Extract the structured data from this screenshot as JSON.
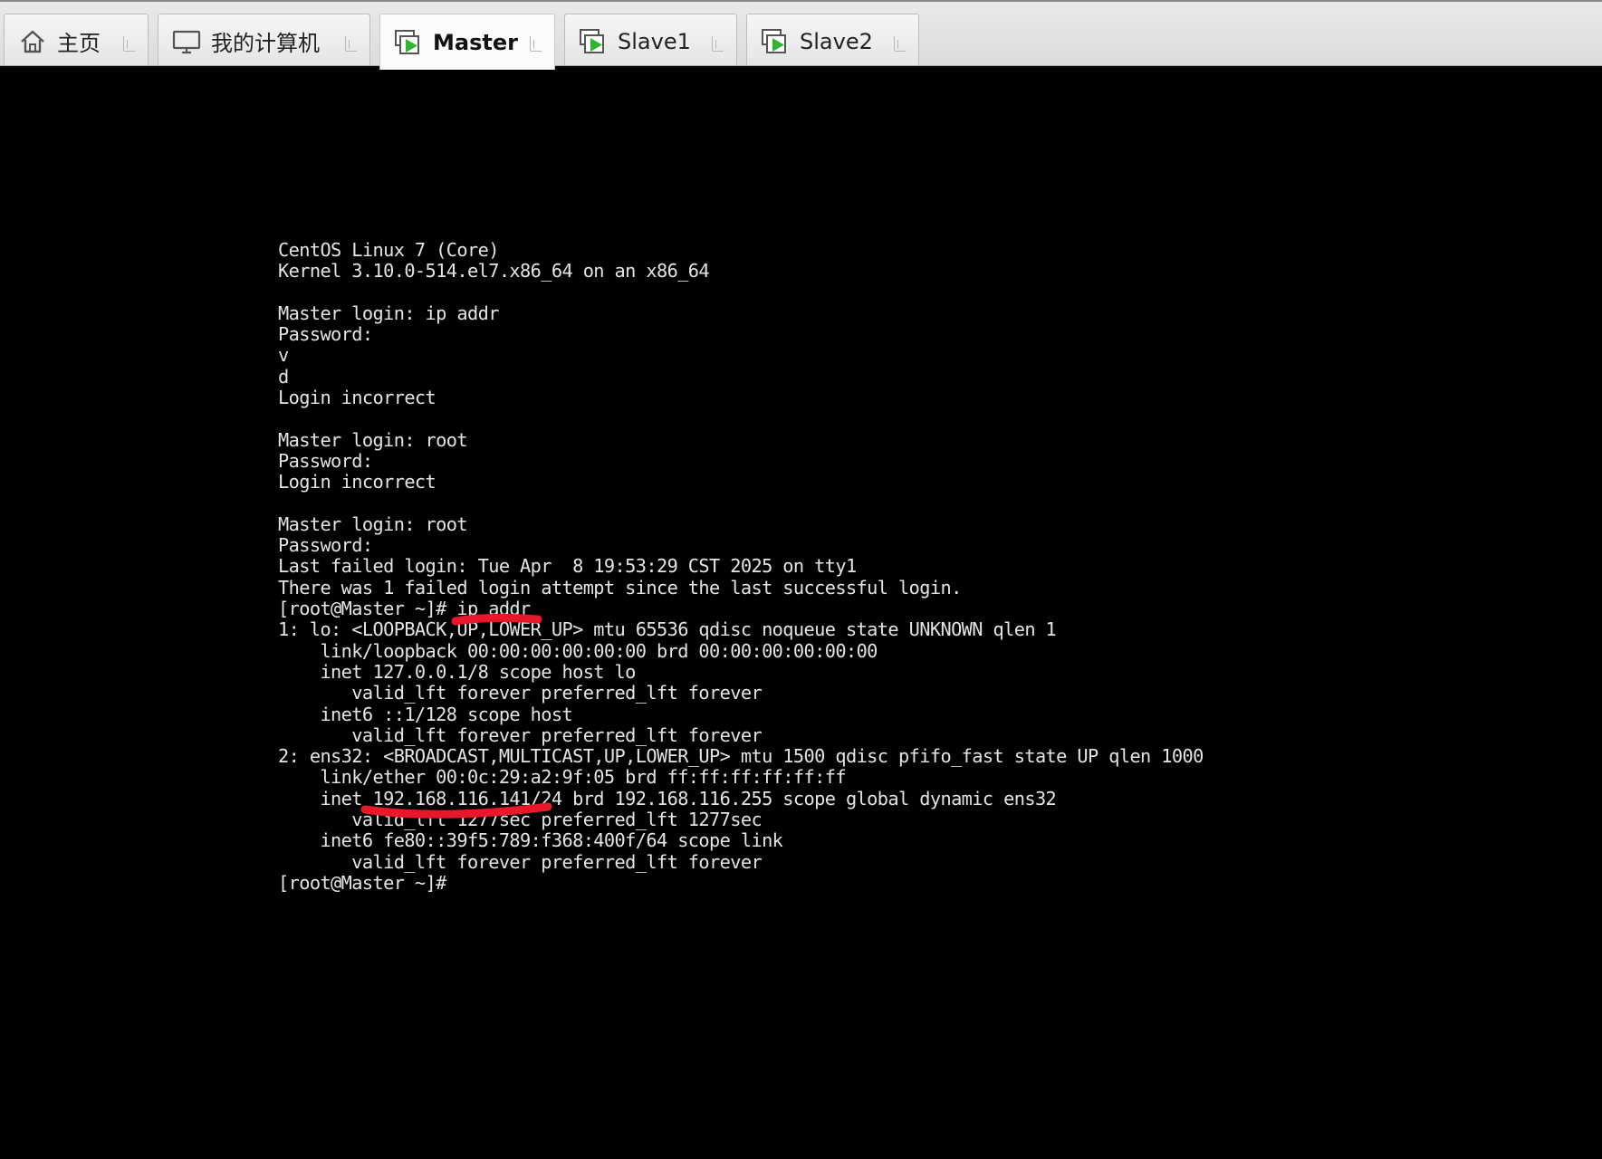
{
  "tabs": [
    {
      "label": "主页",
      "icon": "home-icon",
      "active": false
    },
    {
      "label": "我的计算机",
      "icon": "computer-icon",
      "active": false
    },
    {
      "label": "Master",
      "icon": "vm-running-icon",
      "active": true
    },
    {
      "label": "Slave1",
      "icon": "vm-running-icon",
      "active": false
    },
    {
      "label": "Slave2",
      "icon": "vm-running-icon",
      "active": false
    }
  ],
  "colors": {
    "console_bg": "#000000",
    "console_text": "#e4e4e4",
    "annotation_red": "#e8182a",
    "vm_play_green": "#2fb52f"
  },
  "terminal": {
    "lines": [
      "CentOS Linux 7 (Core)",
      "Kernel 3.10.0-514.el7.x86_64 on an x86_64",
      "",
      "Master login: ip addr",
      "Password:",
      "v",
      "d",
      "Login incorrect",
      "",
      "Master login: root",
      "Password:",
      "Login incorrect",
      "",
      "Master login: root",
      "Password:",
      "Last failed login: Tue Apr  8 19:53:29 CST 2025 on tty1",
      "There was 1 failed login attempt since the last successful login.",
      "[root@Master ~]# ip addr",
      "1: lo: <LOOPBACK,UP,LOWER_UP> mtu 65536 qdisc noqueue state UNKNOWN qlen 1",
      "    link/loopback 00:00:00:00:00:00 brd 00:00:00:00:00:00",
      "    inet 127.0.0.1/8 scope host lo",
      "       valid_lft forever preferred_lft forever",
      "    inet6 ::1/128 scope host",
      "       valid_lft forever preferred_lft forever",
      "2: ens32: <BROADCAST,MULTICAST,UP,LOWER_UP> mtu 1500 qdisc pfifo_fast state UP qlen 1000",
      "    link/ether 00:0c:29:a2:9f:05 brd ff:ff:ff:ff:ff:ff",
      "    inet 192.168.116.141/24 brd 192.168.116.255 scope global dynamic ens32",
      "       valid_lft 1277sec preferred_lft 1277sec",
      "    inet6 fe80::39f5:789:f368:400f/64 scope link",
      "       valid_lft forever preferred_lft forever",
      "[root@Master ~]#"
    ]
  }
}
